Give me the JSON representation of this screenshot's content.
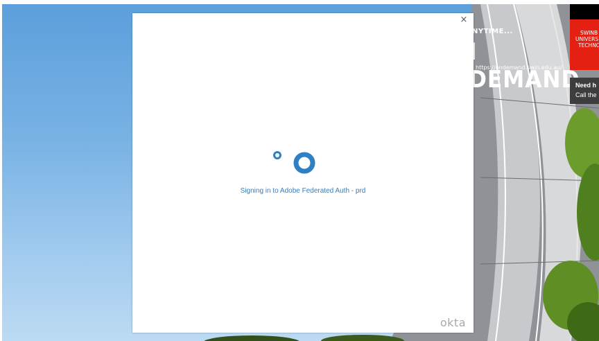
{
  "background": {
    "tagline": "NYTIME...",
    "title": "I DEMAND",
    "url": "https://ondemand.swin.edu.au/",
    "brand_lines": [
      "SWINB",
      "UNIVERS",
      "TECHNC"
    ],
    "help_title": "Need h",
    "help_text": "Call the"
  },
  "modal": {
    "close_label": "×",
    "status_text": "Signing in to Adobe Federated Auth - prd",
    "logo_text": "okta"
  },
  "colors": {
    "accent": "#2f7fc5",
    "brand_red": "#e32012"
  }
}
